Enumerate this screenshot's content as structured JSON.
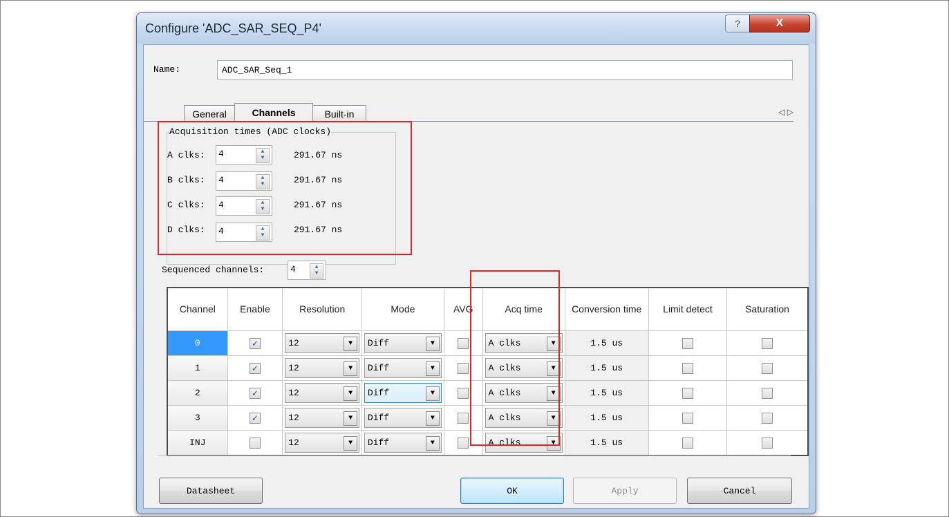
{
  "window": {
    "title": "Configure 'ADC_SAR_SEQ_P4'",
    "help_glyph": "?",
    "close_glyph": "X"
  },
  "name": {
    "label": "Name:",
    "value": "ADC_SAR_Seq_1"
  },
  "tabs": [
    {
      "label": "General",
      "active": false
    },
    {
      "label": "Channels",
      "active": true
    },
    {
      "label": "Built-in",
      "active": false
    }
  ],
  "tab_scroll": "◁ ▷",
  "acquisition": {
    "title": "Acquisition times (ADC clocks)",
    "rows": [
      {
        "label": "A clks:",
        "value": "4",
        "time": "291.67 ns"
      },
      {
        "label": "B clks:",
        "value": "4",
        "time": "291.67 ns"
      },
      {
        "label": "C clks:",
        "value": "4",
        "time": "291.67 ns"
      },
      {
        "label": "D clks:",
        "value": "4",
        "time": "291.67 ns"
      }
    ]
  },
  "sequenced": {
    "label": "Sequenced channels:",
    "value": "4"
  },
  "table": {
    "headers": [
      "Channel",
      "Enable",
      "Resolution",
      "Mode",
      "AVG",
      "Acq time",
      "Conversion time",
      "Limit detect",
      "Saturation"
    ],
    "rows": [
      {
        "channel": "0",
        "enable": true,
        "resolution": "12",
        "mode": "Diff",
        "avg": false,
        "acq": "A clks",
        "conv": "1.5 us",
        "limit": false,
        "sat": false
      },
      {
        "channel": "1",
        "enable": true,
        "resolution": "12",
        "mode": "Diff",
        "avg": false,
        "acq": "A clks",
        "conv": "1.5 us",
        "limit": false,
        "sat": false
      },
      {
        "channel": "2",
        "enable": true,
        "resolution": "12",
        "mode": "Diff",
        "avg": false,
        "acq": "A clks",
        "conv": "1.5 us",
        "limit": false,
        "sat": false
      },
      {
        "channel": "3",
        "enable": true,
        "resolution": "12",
        "mode": "Diff",
        "avg": false,
        "acq": "A clks",
        "conv": "1.5 us",
        "limit": false,
        "sat": false
      },
      {
        "channel": "INJ",
        "enable": false,
        "resolution": "12",
        "mode": "Diff",
        "avg": false,
        "acq": "A clks",
        "conv": "1.5 us",
        "limit": false,
        "sat": false
      }
    ]
  },
  "buttons": {
    "datasheet": "Datasheet",
    "ok": "OK",
    "apply": "Apply",
    "cancel": "Cancel"
  },
  "colors": {
    "highlight_box": "#e0262a",
    "selected_row": "#3399ff"
  }
}
